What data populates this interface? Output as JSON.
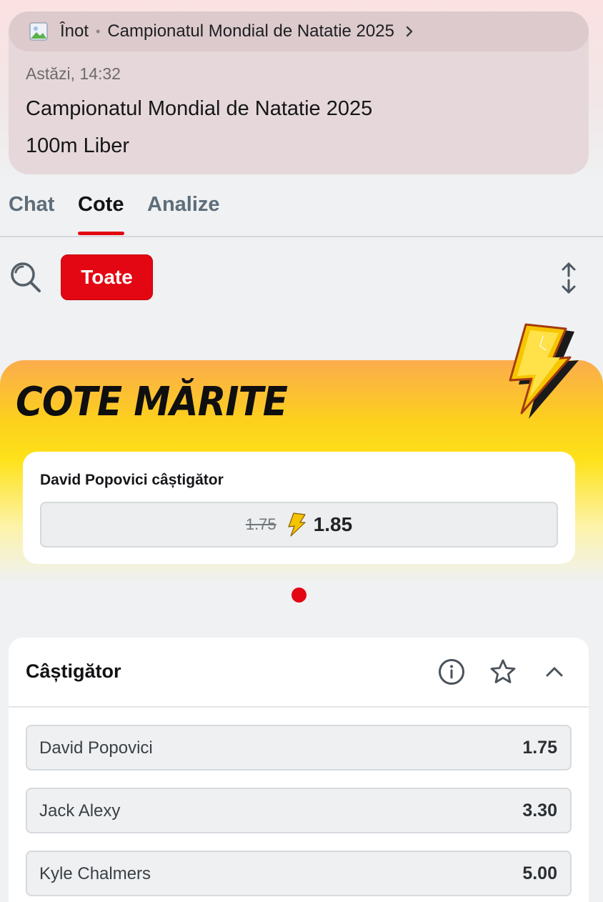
{
  "event": {
    "breadcrumb_sport": "Înot",
    "breadcrumb_separator": "•",
    "breadcrumb_competition": "Campionatul Mondial de Natatie 2025",
    "time": "Astăzi, 14:32",
    "title": "Campionatul Mondial de Natatie 2025",
    "subtitle": "100m Liber"
  },
  "tabs": [
    {
      "label": "Chat",
      "active": false
    },
    {
      "label": "Cote",
      "active": true
    },
    {
      "label": "Analize",
      "active": false
    }
  ],
  "filters": {
    "active_label": "Toate"
  },
  "promo": {
    "title": "COTE MĂRITE",
    "selection": "David Popovici câștigător",
    "old_odds": "1.75",
    "new_odds": "1.85"
  },
  "market": {
    "title": "Câștigător",
    "selections": [
      {
        "name": "David Popovici",
        "odds": "1.75"
      },
      {
        "name": "Jack Alexy",
        "odds": "3.30"
      },
      {
        "name": "Kyle Chalmers",
        "odds": "5.00"
      }
    ]
  },
  "colors": {
    "accent": "#e30613",
    "promo_orange": "#fbac4d",
    "promo_yellow": "#fde21a"
  },
  "icons": [
    "image-placeholder-icon",
    "chevron-right-icon",
    "search-icon",
    "sort-icon",
    "lightning-bolt-icon",
    "info-icon",
    "star-icon",
    "chevron-up-icon"
  ]
}
